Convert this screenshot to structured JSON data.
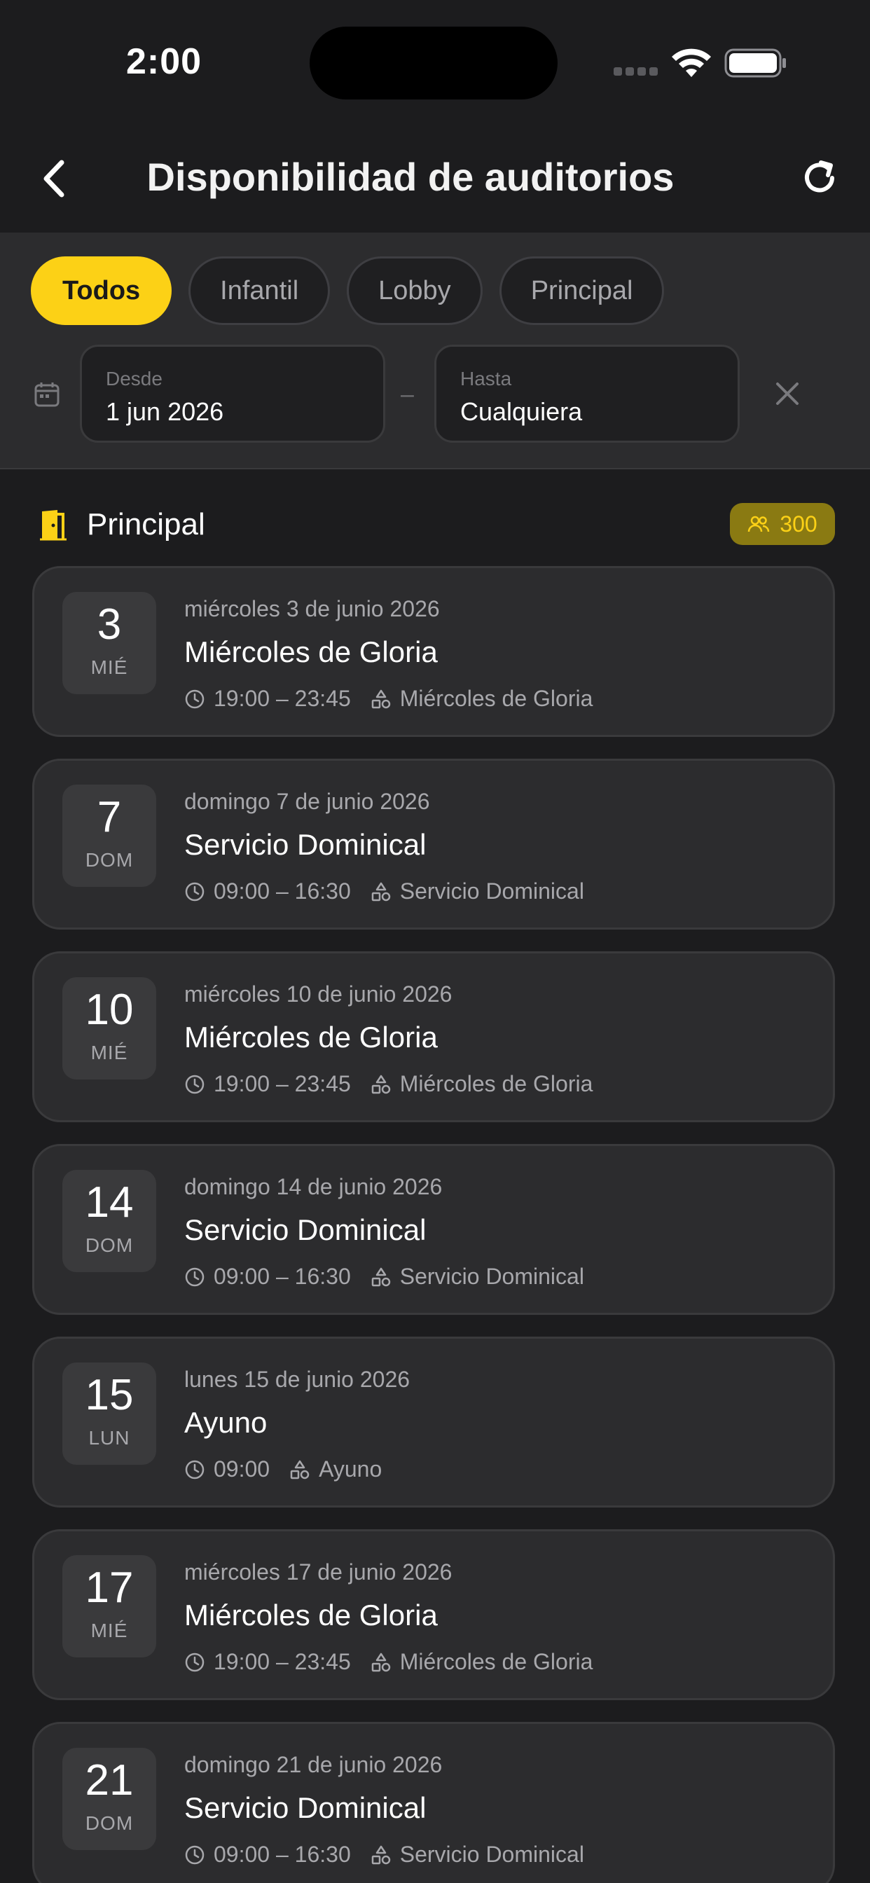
{
  "status_bar": {
    "time": "2:00"
  },
  "nav": {
    "title": "Disponibilidad de auditorios"
  },
  "filters": {
    "chips": [
      {
        "label": "Todos",
        "active": true
      },
      {
        "label": "Infantil",
        "active": false
      },
      {
        "label": "Lobby",
        "active": false
      },
      {
        "label": "Principal",
        "active": false
      }
    ],
    "from": {
      "label": "Desde",
      "value": "1 jun 2026"
    },
    "separator": "–",
    "to": {
      "label": "Hasta",
      "value": "Cualquiera"
    }
  },
  "section": {
    "title": "Principal",
    "capacity": "300"
  },
  "events": [
    {
      "day": "3",
      "dow": "MIÉ",
      "date": "miércoles 3 de junio 2026",
      "title": "Miércoles de Gloria",
      "time": "19:00 – 23:45",
      "category": "Miércoles de Gloria"
    },
    {
      "day": "7",
      "dow": "DOM",
      "date": "domingo 7 de junio 2026",
      "title": "Servicio Dominical",
      "time": "09:00 – 16:30",
      "category": "Servicio Dominical"
    },
    {
      "day": "10",
      "dow": "MIÉ",
      "date": "miércoles 10 de junio 2026",
      "title": "Miércoles de Gloria",
      "time": "19:00 – 23:45",
      "category": "Miércoles de Gloria"
    },
    {
      "day": "14",
      "dow": "DOM",
      "date": "domingo 14 de junio 2026",
      "title": "Servicio Dominical",
      "time": "09:00 – 16:30",
      "category": "Servicio Dominical"
    },
    {
      "day": "15",
      "dow": "LUN",
      "date": "lunes 15 de junio 2026",
      "title": "Ayuno",
      "time": "09:00",
      "category": "Ayuno"
    },
    {
      "day": "17",
      "dow": "MIÉ",
      "date": "miércoles 17 de junio 2026",
      "title": "Miércoles de Gloria",
      "time": "19:00 – 23:45",
      "category": "Miércoles de Gloria"
    },
    {
      "day": "21",
      "dow": "DOM",
      "date": "domingo 21 de junio 2026",
      "title": "Servicio Dominical",
      "time": "09:00 – 16:30",
      "category": "Servicio Dominical"
    }
  ],
  "colors": {
    "accent": "#fcd116",
    "background": "#1c1c1e",
    "card": "#2c2c2e"
  },
  "icons": [
    "back-chevron-icon",
    "refresh-icon",
    "calendar-icon",
    "close-icon",
    "door-icon",
    "people-icon",
    "clock-icon",
    "shapes-icon"
  ]
}
